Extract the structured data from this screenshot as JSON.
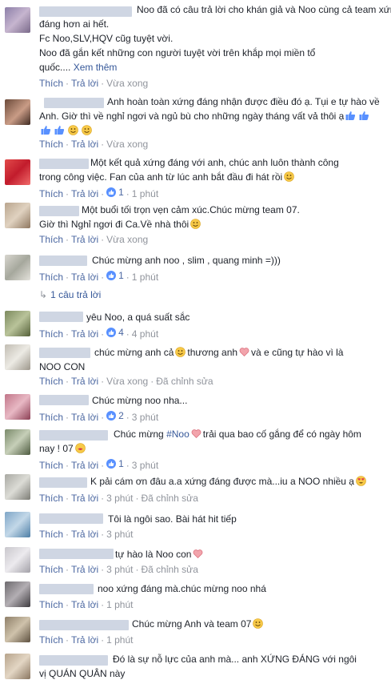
{
  "labels": {
    "like": "Thích",
    "reply": "Trả lời",
    "see_more": "Xem thêm",
    "edited": "Đã chỉnh sửa"
  },
  "comments": [
    {
      "lines": [
        "Noo đã có câu trả lời cho khán giả và Noo cùng cả team xứng",
        "đáng hơn ai hết.",
        "Fc Noo,SLV,HQV cũg tuyệt vời.",
        "Noo đã gắn kết những con người tuyệt vời trên khắp mọi miền tổ",
        "quốc...."
      ],
      "time": "Vừa xong"
    },
    {
      "lines": [
        "Anh hoàn toàn xứng đáng nhận được điều đó ạ. Tụi e tự hào về",
        "Anh. Giờ thì về nghỉ ngơi và ngủ bù cho những ngày tháng vất vả thôi ạ"
      ],
      "time": "Vừa xong"
    },
    {
      "lines": [
        "Một kết quả xứng đáng với anh, chúc anh luôn thành công",
        "trong công việc. Fan của anh từ lúc anh bắt đầu đi hát rồi"
      ],
      "likes": "1",
      "time": "1 phút"
    },
    {
      "lines": [
        "Một buổi tối trọn vẹn cảm xúc.Chúc mừng team 07.",
        "Giờ thì Nghỉ ngơi đi Ca.Về nhà thôi"
      ],
      "time": "Vừa xong"
    },
    {
      "lines": [
        "Chúc mừng anh noo , slim , quang minh =)))"
      ],
      "likes": "1",
      "time": "1 phút",
      "replies": "1 câu trả lời"
    },
    {
      "lines": [
        "yêu Noo, a quá suất sắc"
      ],
      "likes": "4",
      "time": "4 phút"
    },
    {
      "lines": [
        "chúc mừng anh cả",
        "thương anh",
        "và e cũng tự hào vì là",
        "NOO CON"
      ],
      "time": "Vừa xong"
    },
    {
      "lines": [
        "Chúc mừng noo nha..."
      ],
      "likes": "2",
      "time": "3 phút"
    },
    {
      "lines": [
        "Chúc mừng",
        "#Noo",
        "trải qua bao cố gắng để có ngày hôm",
        "nay ! 07"
      ],
      "likes": "1",
      "time": "3 phút"
    },
    {
      "lines": [
        "K pải cám ơn đâu a.a xứng đáng được mà...iu a NOO nhiều ạ"
      ],
      "time": "3 phút"
    },
    {
      "lines": [
        "Tôi là ngôi sao. Bài hát hit tiếp"
      ],
      "time": "3 phút"
    },
    {
      "lines": [
        "tự hào là Noo con"
      ],
      "time": "3 phút"
    },
    {
      "lines": [
        "noo xứng đáng mà.chúc mừng noo nhá"
      ],
      "time": "1 phút"
    },
    {
      "lines": [
        "Chúc mừng Anh và team 07"
      ],
      "time": "1 phút"
    },
    {
      "lines": [
        "Đó là sự nỗ lực của anh mà... anh XỨNG ĐÁNG với ngôi",
        "vị QUÁN QUÂN này"
      ]
    }
  ]
}
